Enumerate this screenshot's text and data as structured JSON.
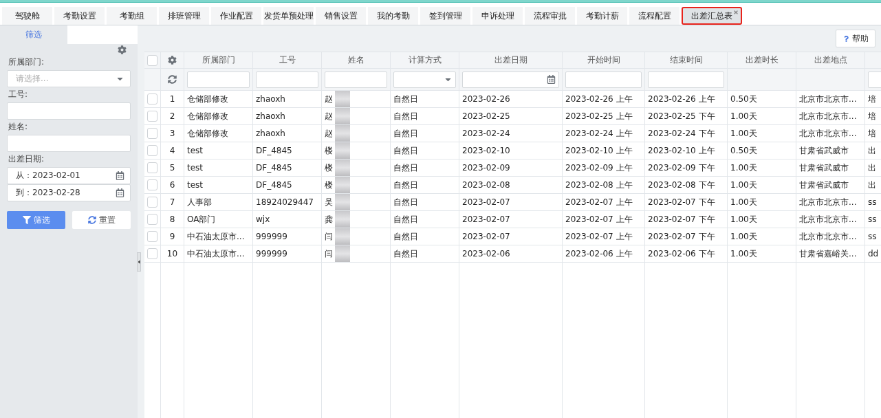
{
  "tabs": [
    {
      "label": "驾驶舱",
      "selected": false
    },
    {
      "label": "考勤设置",
      "selected": false
    },
    {
      "label": "考勤组",
      "selected": false
    },
    {
      "label": "排班管理",
      "selected": false
    },
    {
      "label": "作业配置",
      "selected": false
    },
    {
      "label": "发货单预处理",
      "selected": false
    },
    {
      "label": "销售设置",
      "selected": false
    },
    {
      "label": "我的考勤",
      "selected": false
    },
    {
      "label": "签到管理",
      "selected": false
    },
    {
      "label": "申诉处理",
      "selected": false
    },
    {
      "label": "流程审批",
      "selected": false
    },
    {
      "label": "考勤计薪",
      "selected": false
    },
    {
      "label": "流程配置",
      "selected": false
    },
    {
      "label": "出差汇总表",
      "selected": true,
      "closable": true
    }
  ],
  "sidebar": {
    "tab": "筛选",
    "fields": [
      {
        "kind": "select",
        "label": "所属部门:",
        "placeholder": "请选择..."
      },
      {
        "kind": "text",
        "label": "工号:"
      },
      {
        "kind": "text",
        "label": "姓名:"
      }
    ],
    "date_label": "出差日期:",
    "date_from": "从：2023-02-01",
    "date_to": "到：2023-02-28",
    "filter_button": "筛选",
    "reset_button": "重置"
  },
  "help_button": "帮助",
  "table": {
    "select_all_checked": false,
    "columns": [
      {
        "label": "所属部门",
        "kind": "text"
      },
      {
        "label": "工号",
        "kind": "text"
      },
      {
        "label": "姓名",
        "kind": "text"
      },
      {
        "label": "计算方式",
        "kind": "select"
      },
      {
        "label": "出差日期",
        "kind": "date"
      },
      {
        "label": "开始时间",
        "kind": "text"
      },
      {
        "label": "结束时间",
        "kind": "text"
      },
      {
        "label": "出差时长",
        "kind": "plain"
      },
      {
        "label": "出差地点",
        "kind": "plain"
      },
      {
        "kind": "text"
      }
    ],
    "rows": [
      {
        "no": "1",
        "checked": false,
        "cells": [
          "仓储部修改",
          "zhaoxh",
          "赵",
          "自然日",
          "2023-02-26",
          "2023-02-26 上午",
          "2023-02-26 上午",
          "0.50天",
          "北京市北京市...",
          "培"
        ]
      },
      {
        "no": "2",
        "checked": false,
        "cells": [
          "仓储部修改",
          "zhaoxh",
          "赵",
          "自然日",
          "2023-02-25",
          "2023-02-25 上午",
          "2023-02-25 下午",
          "1.00天",
          "北京市北京市...",
          "培"
        ]
      },
      {
        "no": "3",
        "checked": false,
        "cells": [
          "仓储部修改",
          "zhaoxh",
          "赵",
          "自然日",
          "2023-02-24",
          "2023-02-24 上午",
          "2023-02-24 下午",
          "1.00天",
          "北京市北京市...",
          "培"
        ]
      },
      {
        "no": "4",
        "checked": false,
        "cells": [
          "test",
          "DF_4845",
          "楼",
          "自然日",
          "2023-02-10",
          "2023-02-10 上午",
          "2023-02-10 上午",
          "0.50天",
          "甘肃省武威市",
          "出"
        ]
      },
      {
        "no": "5",
        "checked": false,
        "cells": [
          "test",
          "DF_4845",
          "楼",
          "自然日",
          "2023-02-09",
          "2023-02-09 上午",
          "2023-02-09 下午",
          "1.00天",
          "甘肃省武威市",
          "出"
        ]
      },
      {
        "no": "6",
        "checked": false,
        "cells": [
          "test",
          "DF_4845",
          "楼",
          "自然日",
          "2023-02-08",
          "2023-02-08 上午",
          "2023-02-08 下午",
          "1.00天",
          "甘肃省武威市",
          "出"
        ]
      },
      {
        "no": "7",
        "checked": false,
        "cells": [
          "人事部",
          "18924029447",
          "吴",
          "自然日",
          "2023-02-07",
          "2023-02-07 上午",
          "2023-02-07 下午",
          "1.00天",
          "北京市北京市...",
          "ss"
        ]
      },
      {
        "no": "8",
        "checked": false,
        "cells": [
          "OA部门",
          "wjx",
          "龚",
          "自然日",
          "2023-02-07",
          "2023-02-07 上午",
          "2023-02-07 下午",
          "1.00天",
          "北京市北京市...",
          "ss"
        ]
      },
      {
        "no": "9",
        "checked": false,
        "cells": [
          "中石油太原市...",
          "999999",
          "闫",
          "自然日",
          "2023-02-07",
          "2023-02-07 上午",
          "2023-02-07 下午",
          "1.00天",
          "北京市北京市...",
          "ss"
        ]
      },
      {
        "no": "10",
        "checked": false,
        "cells": [
          "中石油太原市...",
          "999999",
          "闫",
          "自然日",
          "2023-02-06",
          "2023-02-06 上午",
          "2023-02-06 下午",
          "1.00天",
          "甘肃省嘉峪关...",
          "dd"
        ]
      }
    ]
  }
}
